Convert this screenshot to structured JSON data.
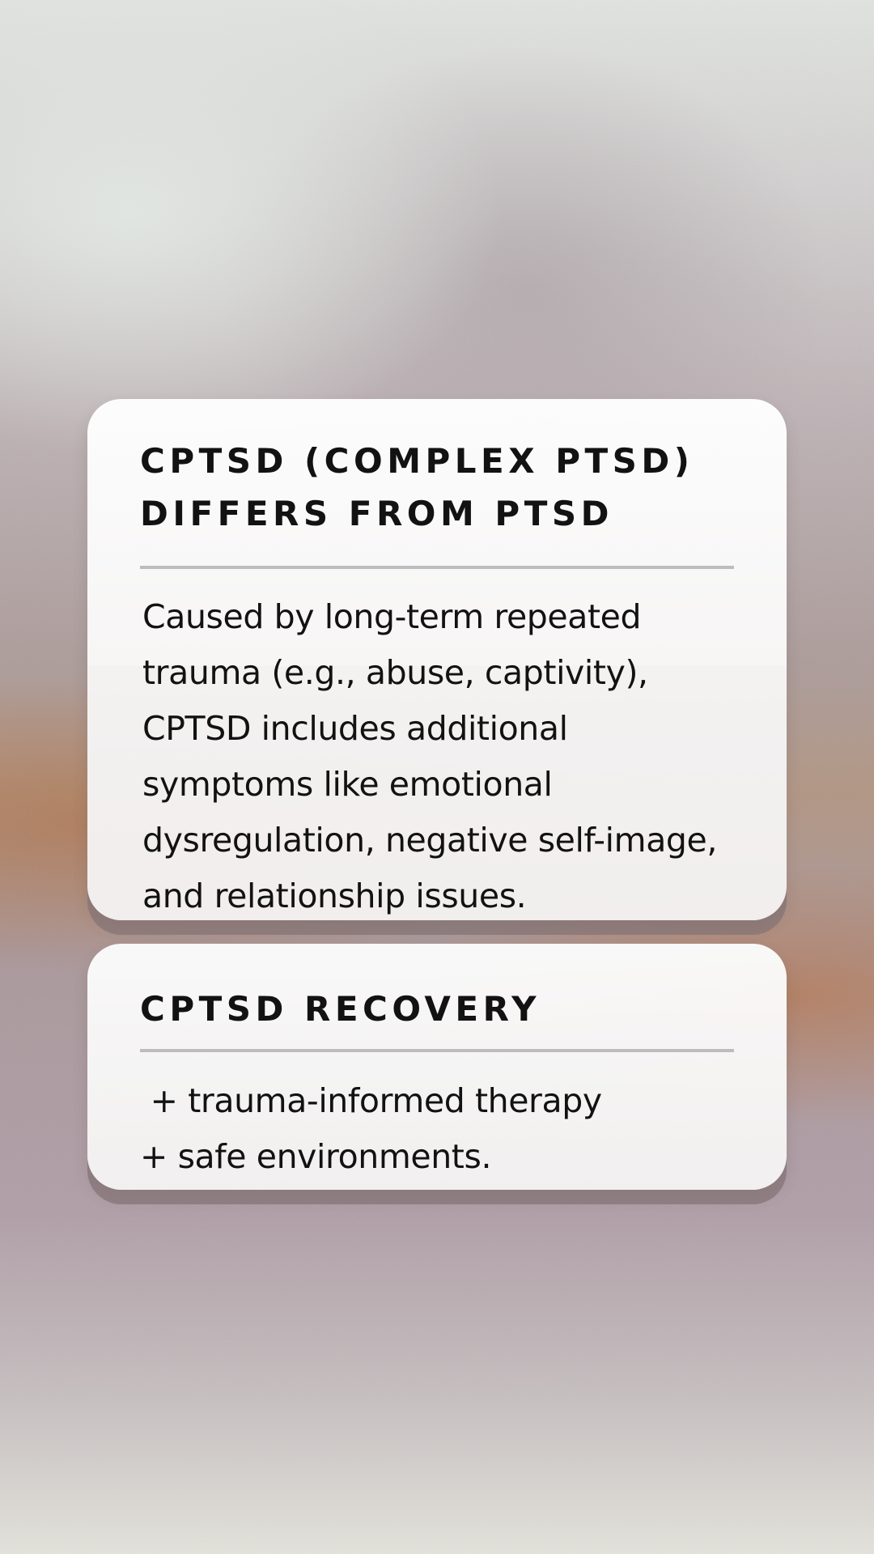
{
  "cards": [
    {
      "title": "CPTSD (COMPLEX PTSD)\nDIFFERS FROM PTSD",
      "body": "Caused by long-term repeated\ntrauma (e.g., abuse, captivity),\nCPTSD includes additional\nsymptoms like emotional\ndysregulation, negative self-image,\nand relationship issues."
    },
    {
      "title": "CPTSD RECOVERY",
      "items": [
        " + trauma-informed therapy",
        "+ safe environments."
      ]
    }
  ]
}
